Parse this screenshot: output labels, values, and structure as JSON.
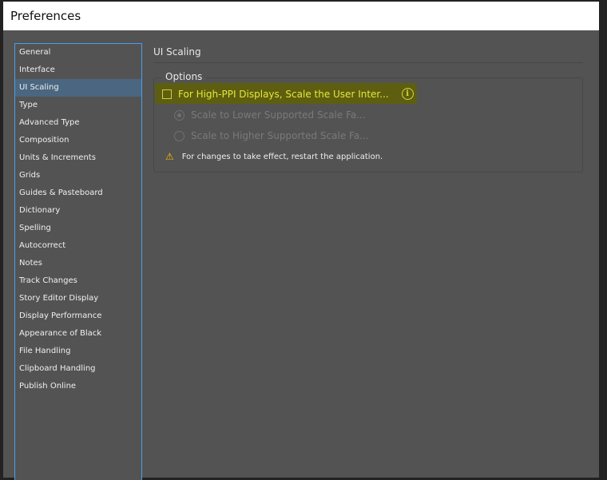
{
  "window": {
    "title": "Preferences"
  },
  "sidebar": {
    "items": [
      "General",
      "Interface",
      "UI Scaling",
      "Type",
      "Advanced Type",
      "Composition",
      "Units & Increments",
      "Grids",
      "Guides & Pasteboard",
      "Dictionary",
      "Spelling",
      "Autocorrect",
      "Notes",
      "Track Changes",
      "Story Editor Display",
      "Display Performance",
      "Appearance of Black",
      "File Handling",
      "Clipboard Handling",
      "Publish Online"
    ],
    "selected": "UI Scaling"
  },
  "main": {
    "heading": "UI Scaling",
    "group_label": "Options",
    "scale_checkbox": {
      "label": "For High-PPI Displays, Scale the User Inter...",
      "checked": false
    },
    "radio_lower": {
      "label": "Scale to Lower Supported Scale Fa...",
      "selected": true,
      "enabled": false
    },
    "radio_higher": {
      "label": "Scale to Higher Supported Scale Fa...",
      "selected": false,
      "enabled": false
    },
    "warning": "For changes to take effect, restart the application."
  },
  "colors": {
    "highlight": "#5e5e10",
    "selection": "#4b6680",
    "focus_border": "#4a9fe8"
  }
}
